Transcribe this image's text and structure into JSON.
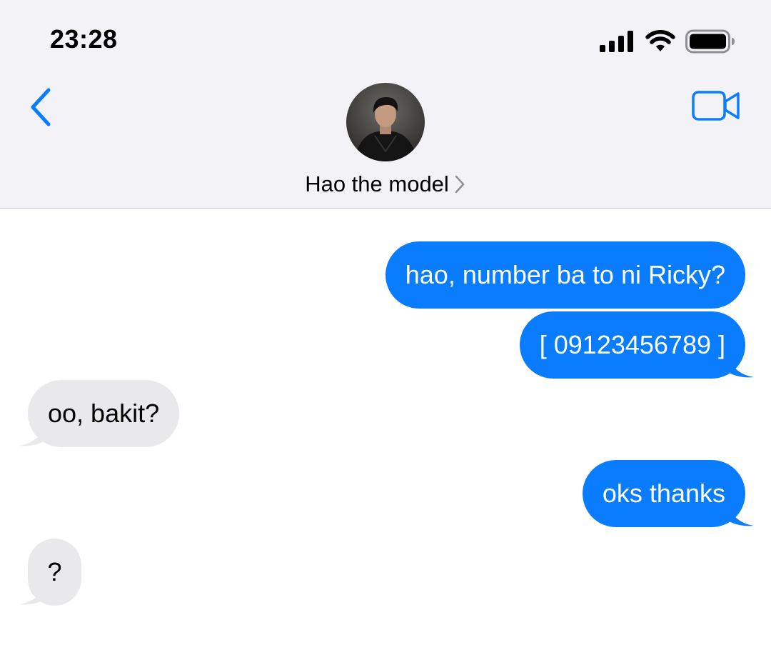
{
  "status_bar": {
    "time": "23:28",
    "signal_icon": "cellular-signal-icon",
    "wifi_icon": "wifi-icon",
    "battery_icon": "battery-icon"
  },
  "nav": {
    "back_icon": "chevron-left-icon",
    "video_icon": "video-camera-icon",
    "contact_name": "Hao the model",
    "contact_chevron_icon": "chevron-right-icon"
  },
  "colors": {
    "accent": "#0a7cff",
    "sent_bubble": "#0a7cff",
    "received_bubble": "#e9e9eb",
    "header_bg": "#f2f2f7"
  },
  "messages": [
    {
      "direction": "sent",
      "text": "hao, number ba to ni Ricky?"
    },
    {
      "direction": "sent",
      "text": "[ 09123456789 ]"
    },
    {
      "direction": "received",
      "text": "oo, bakit?"
    },
    {
      "direction": "sent",
      "text": "oks thanks"
    },
    {
      "direction": "received",
      "text": "?"
    }
  ]
}
